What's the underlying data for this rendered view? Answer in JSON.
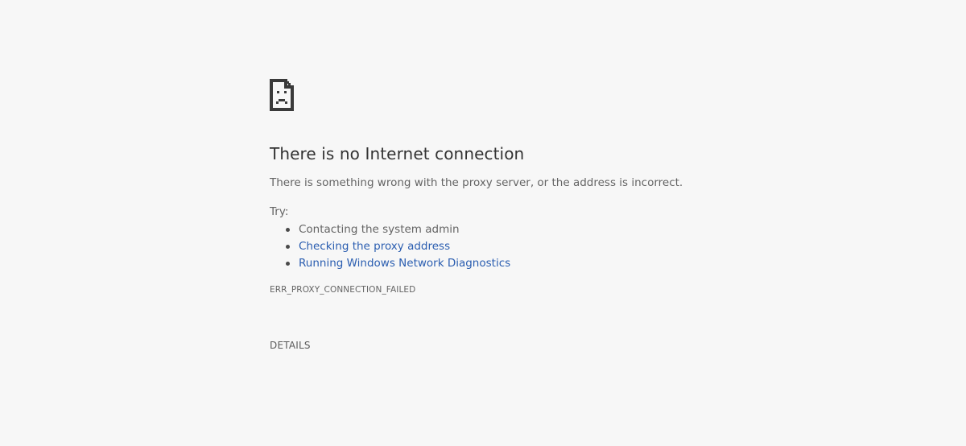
{
  "icon": "sad-document-icon",
  "headline": "There is no Internet connection",
  "description": "There is something wrong with the proxy server, or the address is incorrect.",
  "try_label": "Try:",
  "suggestions": [
    {
      "text": "Contacting the system admin",
      "link": false
    },
    {
      "text": "Checking the proxy address",
      "link": true
    },
    {
      "text": "Running Windows Network Diagnostics",
      "link": true
    }
  ],
  "error_code": "ERR_PROXY_CONNECTION_FAILED",
  "details_button": "DETAILS",
  "colors": {
    "background": "#f7f7f7",
    "headline": "#333333",
    "body_text": "#646464",
    "link": "#2a5db0"
  }
}
